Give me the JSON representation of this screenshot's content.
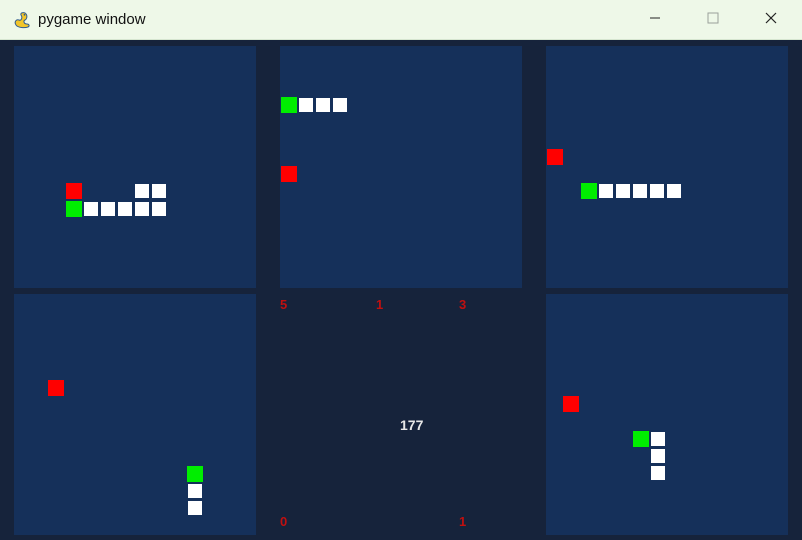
{
  "window": {
    "title": "pygame window",
    "title_icon": "pygame-snake-icon",
    "controls": [
      "minimize-icon",
      "maximize-icon",
      "close-icon"
    ]
  },
  "game": {
    "center_counter": "177",
    "scores": {
      "top_left": "5",
      "top_middle": "1",
      "top_right": "3",
      "bottom_left": "0",
      "bottom_right": "1"
    },
    "colors": {
      "background": "#16233b",
      "board": "#15305a",
      "snake_head": "#00ee00",
      "snake_body": "#ffffff",
      "food": "#ff0000",
      "score_text": "#c01010",
      "counter_text": "#e8e8e8"
    },
    "boards": [
      {
        "id": "board-1",
        "snake_length": 7
      },
      {
        "id": "board-2",
        "snake_length": 4
      },
      {
        "id": "board-3",
        "snake_length": 6
      },
      {
        "id": "board-4",
        "snake_length": 3
      },
      {
        "id": "board-5",
        "snake_length": 4
      }
    ]
  }
}
